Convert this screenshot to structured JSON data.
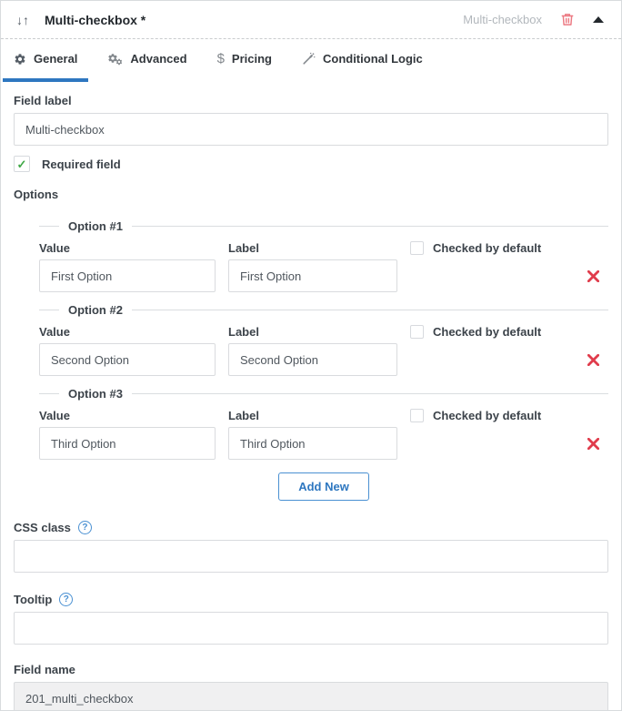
{
  "colors": {
    "accent_blue": "#2e77c0",
    "button_border_blue": "#4a90d2",
    "trash_red": "#ec7a83",
    "delete_x_red": "#e03c4c",
    "check_green": "#3fa846",
    "readonly_bg": "#f0f0f1",
    "type_label_gray": "#b2b7bc"
  },
  "icons": {
    "drag": "↓↑",
    "check": "✓",
    "dollar": "$",
    "help": "?"
  },
  "header": {
    "title": "Multi-checkbox *",
    "type_label": "Multi-checkbox"
  },
  "tabs": [
    {
      "label": "General",
      "icon": "gear-icon",
      "active": true
    },
    {
      "label": "Advanced",
      "icon": "gears-icon",
      "active": false
    },
    {
      "label": "Pricing",
      "icon": "dollar-icon",
      "active": false
    },
    {
      "label": "Conditional Logic",
      "icon": "magic-wand-icon",
      "active": false
    }
  ],
  "general": {
    "field_label": {
      "label": "Field label",
      "value": "Multi-checkbox"
    },
    "required": {
      "label": "Required field",
      "checked": true
    },
    "options_label": "Options",
    "options": [
      {
        "legend": "Option #1",
        "value_label": "Value",
        "value": "First Option",
        "label_label": "Label",
        "label": "First Option",
        "checked_label": "Checked by default",
        "checked_by_default": false
      },
      {
        "legend": "Option #2",
        "value_label": "Value",
        "value": "Second Option",
        "label_label": "Label",
        "label": "Second Option",
        "checked_label": "Checked by default",
        "checked_by_default": false
      },
      {
        "legend": "Option #3",
        "value_label": "Value",
        "value": "Third Option",
        "label_label": "Label",
        "label": "Third Option",
        "checked_label": "Checked by default",
        "checked_by_default": false
      }
    ],
    "add_new_label": "Add New",
    "css_class": {
      "label": "CSS class",
      "value": ""
    },
    "tooltip": {
      "label": "Tooltip",
      "value": ""
    },
    "field_name": {
      "label": "Field name",
      "value": "201_multi_checkbox"
    }
  }
}
